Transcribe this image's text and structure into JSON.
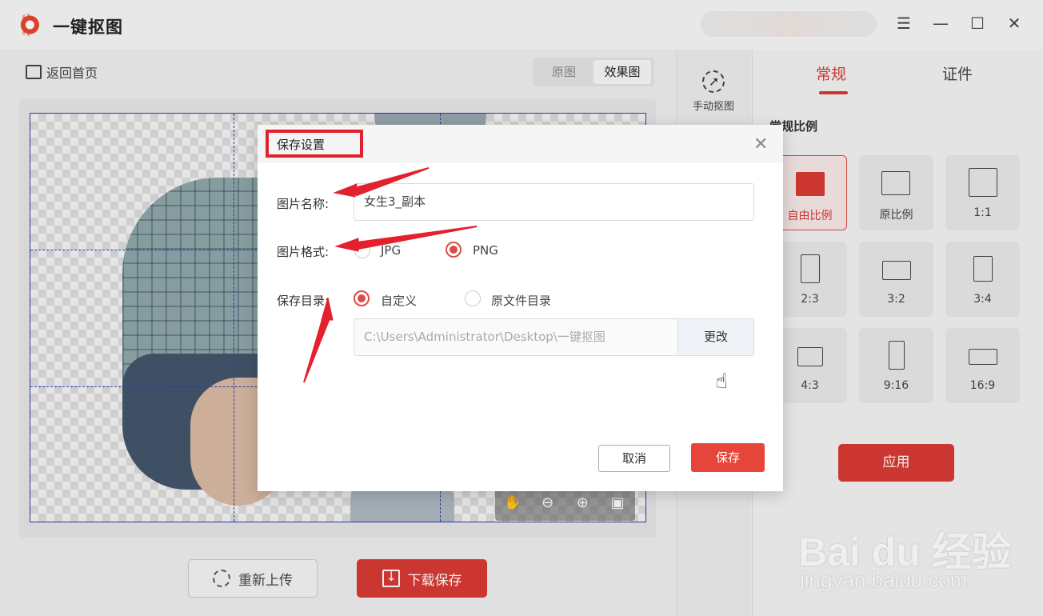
{
  "app": {
    "title": "一键抠图"
  },
  "workspace": {
    "back_home": "返回首页",
    "view_tabs": [
      "原图",
      "效果图"
    ],
    "reupload": "重新上传",
    "download": "下载保存"
  },
  "tools": {
    "manual_cut": "手动抠图"
  },
  "right_panel": {
    "tabs": [
      "常规",
      "证件"
    ],
    "ratio_heading": "常规比例",
    "ratios": [
      "自由比例",
      "原比例",
      "1:1",
      "2:3",
      "3:2",
      "3:4",
      "4:3",
      "9:16",
      "16:9"
    ],
    "selected_ratio": "自由比例",
    "apply": "应用"
  },
  "dialog": {
    "title": "保存设置",
    "name_label": "图片名称:",
    "name_value": "女生3_副本",
    "format_label": "图片格式:",
    "format_options": [
      "JPG",
      "PNG"
    ],
    "format_selected": "PNG",
    "dir_label": "保存目录:",
    "dir_options": [
      "自定义",
      "原文件目录"
    ],
    "dir_selected": "自定义",
    "path_value": "C:\\Users\\Administrator\\Desktop\\一键抠图",
    "change": "更改",
    "cancel": "取消",
    "save": "保存"
  },
  "watermark": {
    "main": "Bai du 经验",
    "sub": "jingyan.baidu.com"
  },
  "colors": {
    "accent": "#d83b33",
    "highlight": "#e3202d",
    "guide": "#2d3fa8"
  }
}
